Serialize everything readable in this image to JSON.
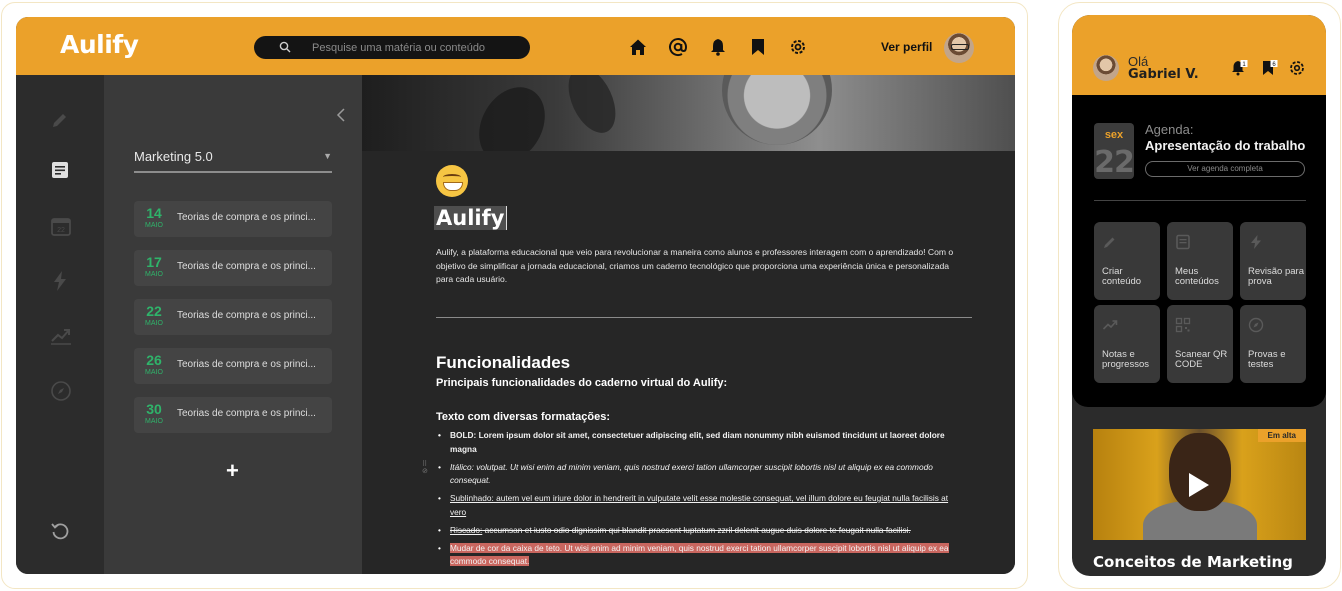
{
  "app": {
    "logo": "Aulify",
    "search_placeholder": "Pesquise uma matéria ou conteúdo",
    "nav_icons": [
      "home-icon",
      "at-icon",
      "bell-icon",
      "bookmark-icon",
      "gear-icon"
    ],
    "profile_link": "Ver perfil",
    "brand_color": "#eba12a",
    "accent_green": "#2fb36a"
  },
  "rail": {
    "icons": [
      "pencil-icon",
      "document-icon",
      "calendar-icon",
      "bolt-icon",
      "trend-icon",
      "compass-icon",
      "undo-icon"
    ]
  },
  "panel": {
    "notebook": "Marketing 5.0",
    "notes": [
      {
        "day": "14",
        "month": "MAIO",
        "title": "Teorias de compra e os princi..."
      },
      {
        "day": "17",
        "month": "MAIO",
        "title": "Teorias de compra e os princi..."
      },
      {
        "day": "22",
        "month": "MAIO",
        "title": "Teorias de compra e os princi..."
      },
      {
        "day": "26",
        "month": "MAIO",
        "title": "Teorias de compra e os princi..."
      },
      {
        "day": "30",
        "month": "MAIO",
        "title": "Teorias de compra e os princi..."
      }
    ],
    "add_label": "+"
  },
  "doc": {
    "title": "Aulify",
    "intro": "Aulify, a plataforma educacional que veio para revolucionar a maneira como alunos e professores interagem com o aprendizado! Com o objetivo de simplificar a jornada educacional, criamos um caderno tecnológico que proporciona uma experiência única e personalizada para cada usuário.",
    "heading": "Funcionalidades",
    "subheading": "Principais funcionalidades do caderno virtual do Aulify:",
    "formats_heading": "Texto com diversas formatações:",
    "items": {
      "bold": "BOLD: Lorem ipsum dolor sit amet, consectetuer adipiscing elit, sed diam nonummy nibh euismod tincidunt ut laoreet dolore magna",
      "italic": "Itálico: volutpat. Ut wisi enim ad minim veniam, quis nostrud exerci tation ullamcorper suscipit lobortis nisl ut aliquip ex ea commodo consequat.",
      "underline": "Sublinhado: autem vel eum iriure dolor in hendrerit in vulputate velit esse molestie consequat, vel illum dolore eu feugiat nulla facilisis at vero",
      "strike_prefix": "Riscado:",
      "strike": " accumsan et iusto odio dignissim qui blandit praesent luptatum zzril delenit augue duis dolore te feugait nulla facilisi.",
      "highlight": "Mudar de cor da caixa de teto. Ut wisi enim ad minim veniam, quis nostrud exerci tation ullamcorper suscipit lobortis nisl ut aliquip ex ea commodo consequat."
    }
  },
  "mobile": {
    "greeting": "Olá",
    "user": "Gabriel V.",
    "bell_count": "1",
    "bookmark_count": "6",
    "agenda": {
      "weekday": "sex",
      "day": "22",
      "label": "Agenda:",
      "title": "Apresentação do trabalho",
      "button": "Ver agenda completa"
    },
    "tiles": [
      {
        "icon": "pencil-icon",
        "label": "Criar conteúdo"
      },
      {
        "icon": "document-icon",
        "label": "Meus conteúdos"
      },
      {
        "icon": "bolt-icon",
        "label": "Revisão para prova"
      },
      {
        "icon": "trend-icon",
        "label": "Notas e progressos"
      },
      {
        "icon": "qr-icon",
        "label": "Scanear QR CODE"
      },
      {
        "icon": "compass-icon",
        "label": "Provas e testes"
      }
    ],
    "badge": "Em alta",
    "course_title": "Conceitos de Marketing"
  }
}
